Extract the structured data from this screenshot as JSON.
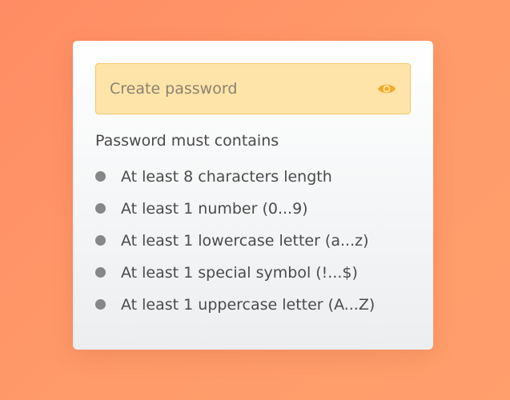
{
  "password_field": {
    "placeholder": "Create password",
    "value": "",
    "toggle_icon": "eye-icon"
  },
  "requirements": {
    "heading": "Password must contains",
    "items": [
      {
        "label": "At least 8 characters length",
        "met": false
      },
      {
        "label": "At least 1 number (0...9)",
        "met": false
      },
      {
        "label": "At least 1 lowercase letter (a...z)",
        "met": false
      },
      {
        "label": "At least 1 special symbol (!...$)",
        "met": false
      },
      {
        "label": "At least 1 uppercase letter (A...Z)",
        "met": false
      }
    ]
  },
  "colors": {
    "background": "#ff9466",
    "field_background": "#ffe4a9",
    "field_border": "#f5c469",
    "accent_icon": "#f5a623",
    "bullet_unmet": "#878787"
  }
}
